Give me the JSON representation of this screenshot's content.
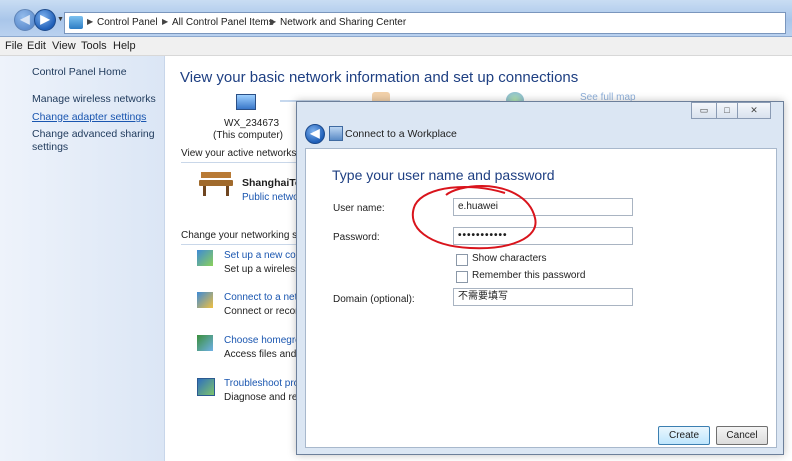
{
  "address_bar": {
    "crumbs": [
      "Control Panel",
      "All Control Panel Items",
      "Network and Sharing Center"
    ]
  },
  "menu": [
    "File",
    "Edit",
    "View",
    "Tools",
    "Help"
  ],
  "left_pane": {
    "home": "Control Panel Home",
    "links": [
      "Manage wireless networks",
      "Change adapter settings",
      "Change advanced sharing",
      "settings"
    ]
  },
  "main": {
    "title": "View your basic network information and set up connections",
    "computer_name": "WX_234673",
    "computer_sub": "(This computer)",
    "see_full_map": "See full map",
    "active_networks_header": "View your active networks",
    "network_name": "ShanghaiTec",
    "network_type": "Public netwo",
    "change_header": "Change your networking se",
    "tasks": [
      {
        "link": "Set up a new con",
        "desc": "Set up a wireless,"
      },
      {
        "link": "Connect to a netw",
        "desc": "Connect or recon"
      },
      {
        "link": "Choose homegro",
        "desc": "Access files and p"
      },
      {
        "link": "Troubleshoot pro",
        "desc": "Diagnose and rep"
      }
    ]
  },
  "dialog": {
    "title": "Connect to a Workplace",
    "heading": "Type your user name and password",
    "username_label": "User name:",
    "username_value": "e.huawei",
    "password_label": "Password:",
    "password_value": "•••••••••••",
    "show_characters": "Show characters",
    "remember_password": "Remember this password",
    "domain_label": "Domain (optional):",
    "domain_value": "不需要填写",
    "create_button": "Create",
    "cancel_button": "Cancel",
    "close_glyph": "✕"
  },
  "colors": {
    "accent_link": "#1a56b0",
    "heading_blue": "#1e3f82",
    "annotation_red": "#d9141c"
  }
}
